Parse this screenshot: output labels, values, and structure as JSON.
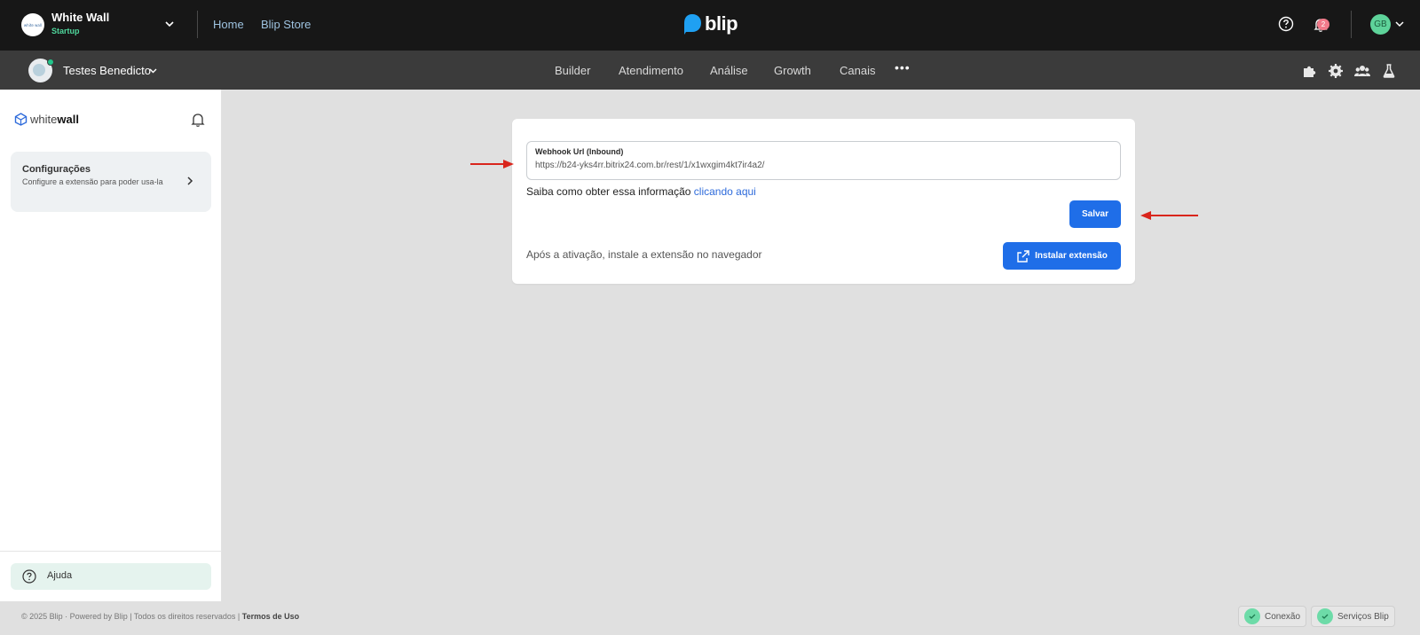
{
  "topbar": {
    "org": {
      "name": "White Wall",
      "plan": "Startup",
      "avatar_text": "white wall"
    },
    "links": [
      "Home",
      "Blip Store"
    ],
    "logo_text": "blip",
    "notifications_count": "2",
    "user_initials": "GB",
    "colors": {
      "background": "#171717",
      "plan": "#4fd69c",
      "link": "#9ec3e0"
    }
  },
  "subbar": {
    "bot_name": "Testes Benedicto",
    "nav": [
      "Builder",
      "Atendimento",
      "Análise",
      "Growth",
      "Canais"
    ],
    "more": "•••",
    "icons": [
      "puzzle-icon",
      "gear-icon",
      "users-icon",
      "flask-icon"
    ]
  },
  "sidebar": {
    "brand_light": "white",
    "brand_bold": "wall",
    "config": {
      "title": "Configurações",
      "description": "Configure a extensão para poder usa-la"
    },
    "help_label": "Ajuda"
  },
  "card": {
    "field_label": "Webhook Url (Inbound)",
    "field_value": "https://b24-yks4rr.bitrix24.com.br/rest/1/x1wxgim4kt7ir4a2/",
    "info_text": "Saiba como obter essa informação",
    "info_link": "clicando aqui",
    "save_label": "Salvar",
    "install_text": "Após a ativação, instale a extensão no navegador",
    "install_label": "Instalar extensão",
    "colors": {
      "primary": "#1f6ee8",
      "link": "#2e6bdb",
      "annotation_arrow": "#d9251c"
    }
  },
  "footer": {
    "copyright": "© 2025 Blip · Powered by Blip | Todos os direitos reservados |",
    "terms": "Termos de Uso",
    "status": [
      {
        "label": "Conexão"
      },
      {
        "label": "Serviços Blip"
      }
    ]
  }
}
